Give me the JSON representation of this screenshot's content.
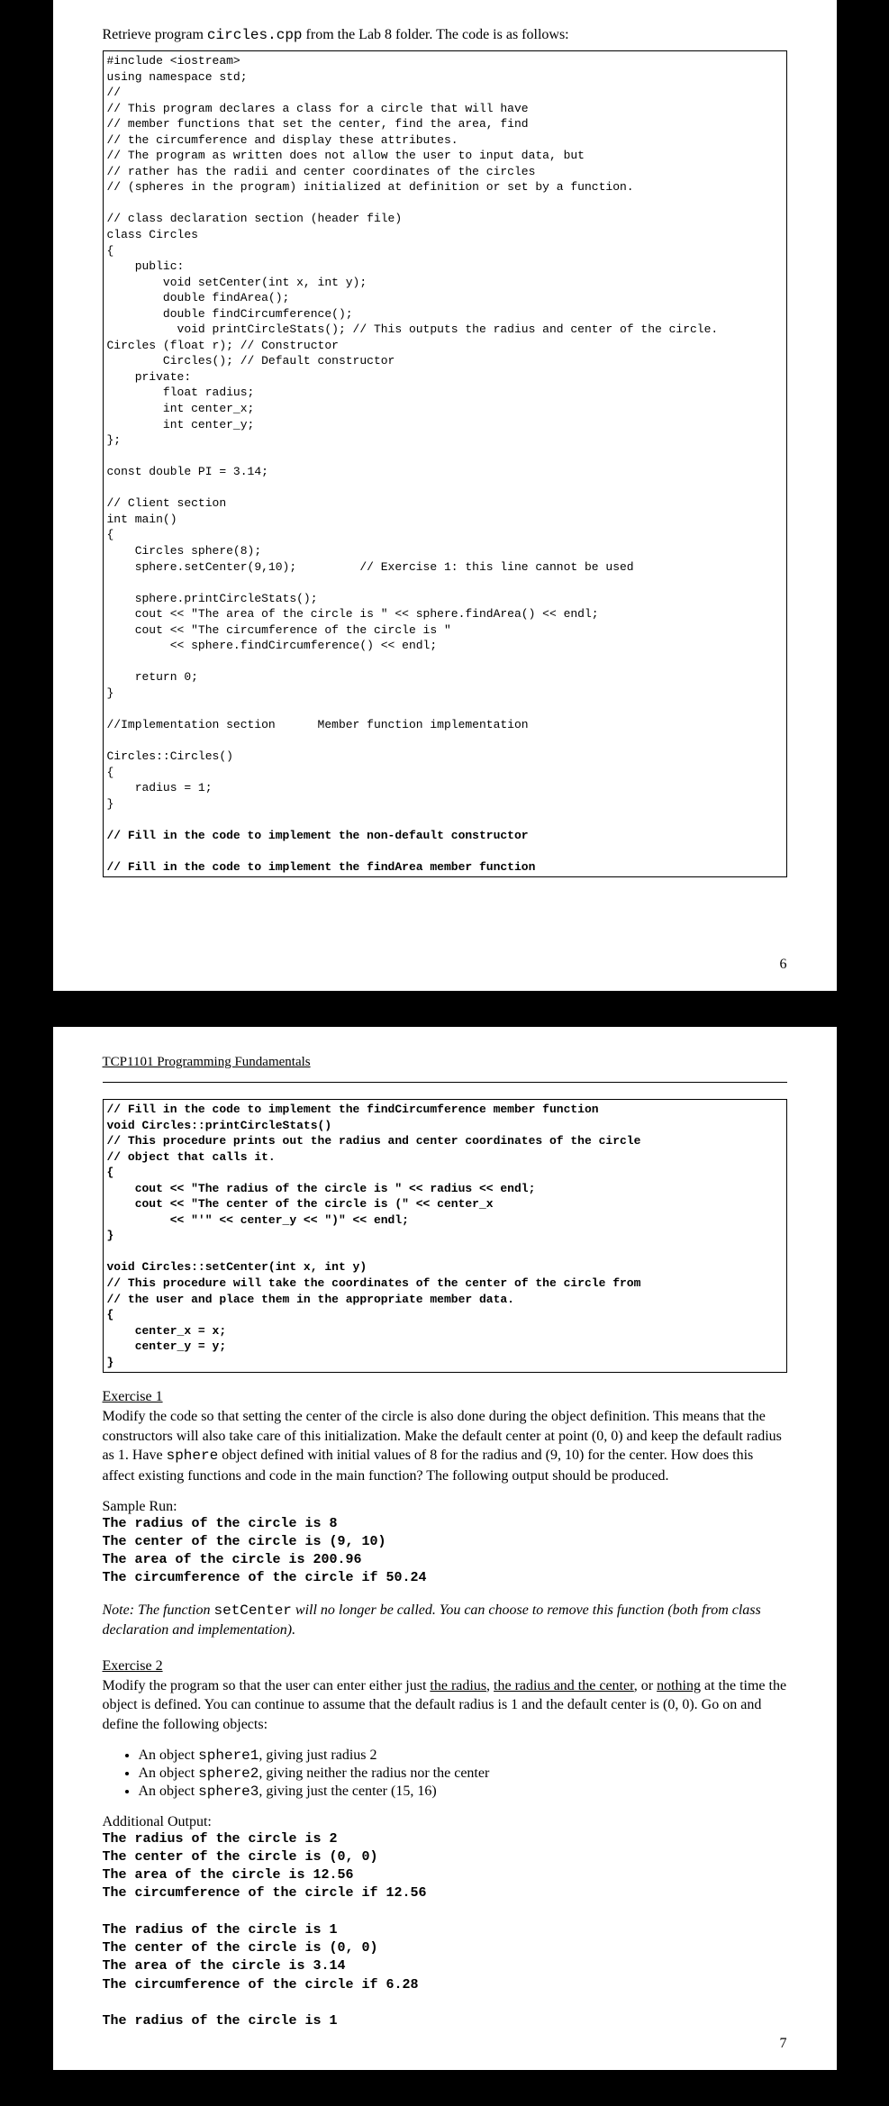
{
  "page1": {
    "intro_prefix": "Retrieve program ",
    "intro_code": "circles.cpp",
    "intro_suffix": " from the Lab 8 folder. The code is as follows:",
    "code": "#include <iostream>\nusing namespace std;\n//\n// This program declares a class for a circle that will have\n// member functions that set the center, find the area, find\n// the circumference and display these attributes.\n// The program as written does not allow the user to input data, but\n// rather has the radii and center coordinates of the circles\n// (spheres in the program) initialized at definition or set by a function.\n\n// class declaration section (header file)\nclass Circles\n{\n    public:\n        void setCenter(int x, int y);\n        double findArea();\n        double findCircumference();\n          void printCircleStats(); // This outputs the radius and center of the circle.\nCircles (float r); // Constructor\n        Circles(); // Default constructor\n    private:\n        float radius;\n        int center_x;\n        int center_y;\n};\n\nconst double PI = 3.14;\n\n// Client section\nint main()\n{\n    Circles sphere(8);\n    sphere.setCenter(9,10);         // Exercise 1: this line cannot be used\n\n    sphere.printCircleStats();\n    cout << \"The area of the circle is \" << sphere.findArea() << endl;\n    cout << \"The circumference of the circle is \"\n         << sphere.findCircumference() << endl;\n\n    return 0;\n}\n\n//Implementation section      Member function implementation\n\nCircles::Circles()\n{\n    radius = 1;\n}\n",
    "code_bold1": "// Fill in the code to implement the non-default constructor",
    "code_bold2": "// Fill in the code to implement the findArea member function",
    "page_num": "6"
  },
  "page2": {
    "header": "TCP1101 Programming Fundamentals",
    "code_bold_first": "// Fill in the code to implement the findCircumference member function",
    "code_rest": "\nvoid Circles::printCircleStats()\n// This procedure prints out the radius and center coordinates of the circle\n// object that calls it.\n{\n    cout << \"The radius of the circle is \" << radius << endl;\n    cout << \"The center of the circle is (\" << center_x\n         << \"'\" << center_y << \")\" << endl;\n}\n\nvoid Circles::setCenter(int x, int y)\n// This procedure will take the coordinates of the center of the circle from\n// the user and place them in the appropriate member data.\n{\n    center_x = x;\n    center_y = y;\n}",
    "ex1_title": "Exercise 1",
    "ex1_body_a": "Modify the code so that setting the center of the circle is also done during the object definition. This means that the constructors will also take care of this initialization. Make the default center at point (0, 0) and keep the default radius as 1. Have ",
    "ex1_body_code": "sphere",
    "ex1_body_b": " object defined with initial values of 8 for the radius and (9, 10) for the center. How does this affect existing functions and code in the main function? The following output should be produced.",
    "sample_run_label": "Sample Run:",
    "sample_run": "The radius of the circle is 8\nThe center of the circle is (9, 10)\nThe area of the circle is 200.96\nThe circumference of the circle if 50.24",
    "note_a": "Note: The function ",
    "note_code": "setCenter",
    "note_b": " will no longer be called. You can choose to remove this function (both from class declaration and implementation).",
    "ex2_title": "Exercise 2",
    "ex2_body_a": "Modify the program so that the user can enter either just ",
    "ex2_u1": "the radius",
    "ex2_body_b": ", ",
    "ex2_u2": "the radius and the center",
    "ex2_body_c": ", or ",
    "ex2_u3": "nothing",
    "ex2_body_d": " at the time the object is defined. You can continue to assume that the default radius is 1 and the default center is (0, 0). Go on and define the following objects:",
    "li1_a": "An object ",
    "li1_code": "sphere1",
    "li1_b": ", giving just radius 2",
    "li2_a": "An object ",
    "li2_code": "sphere2",
    "li2_b": ", giving neither the radius nor the center",
    "li3_a": "An object ",
    "li3_code": "sphere3",
    "li3_b": ", giving just the center (15, 16)",
    "additional_label": "Additional Output:",
    "additional_output": "The radius of the circle is 2\nThe center of the circle is (0, 0)\nThe area of the circle is 12.56\nThe circumference of the circle if 12.56\n\nThe radius of the circle is 1\nThe center of the circle is (0, 0)\nThe area of the circle is 3.14\nThe circumference of the circle if 6.28\n\nThe radius of the circle is 1",
    "page_num": "7"
  }
}
